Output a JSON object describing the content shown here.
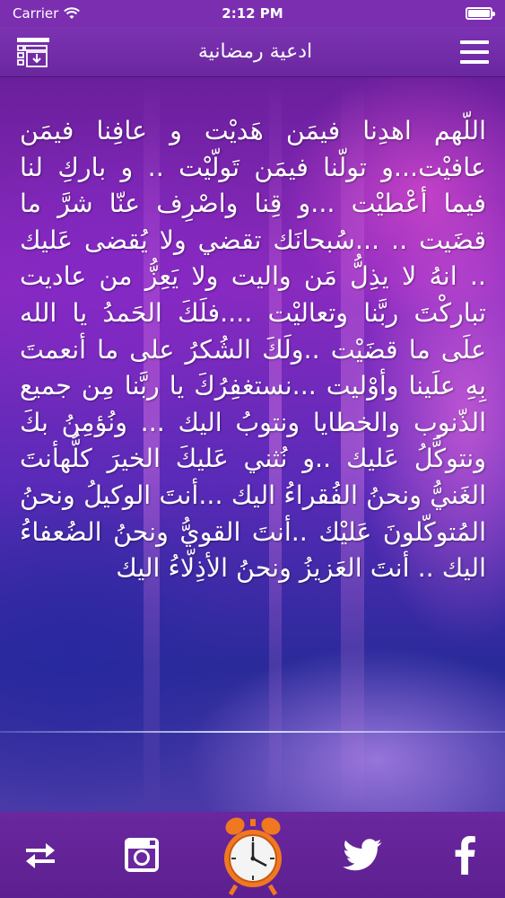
{
  "status_bar": {
    "carrier": "Carrier",
    "time": "2:12 PM"
  },
  "nav": {
    "title": "ادعية رمضانية"
  },
  "dua": {
    "text": "اللّهم اهدِنا فيمَن هَديْت و عافِنا فيمَن عافيْت...و تولّنا فيمَن تَولّيْت .. و باركِ لنا فيما أعْطيْت ...و قِنا واصْرِف عنّا شرَّ ما قضَيت .. ...سُبحانَك تقضي ولا يُقضى عَليك .. انهُ لا يذِلُّ مَن واليت ولا يَعِزُّ من عاديت تباركْتَ ربَّنا وتعاليْت ....فلَكَ الحَمدُ يا الله علَى ما قضَيْت ..ولَكَ الشُكرُ على ما أنعمتَ بِهِ علَينا وأوْليت ...نستغفِرُكَ يا ربَّنا مِن جميع الذّنوب والخطايا ونتوبُ اليك ... ونُؤمِنُ بكَ ونتوكَّلُ عَليك ..و نُثني عَليكَ الخيرَ كلُّهأنتَ الغَنيُّ ونحنُ الفُقراءُ اليك ...أنتَ الوكيلُ ونحنُ المُتوكّلونَ عَليْك ..أنتَ القويُّ ونحنُ الضُعفاءُ اليك .. أنتَ العَزيزُ ونحنُ الأذِلّاءُ اليك"
  },
  "icons": {
    "menu": "hamburger-menu-icon",
    "list": "list-download-icon",
    "facebook": "facebook-icon",
    "twitter": "twitter-icon",
    "alarm": "alarm-clock-icon",
    "instagram": "instagram-icon",
    "refresh": "refresh-arrows-icon"
  },
  "colors": {
    "bar": "#6a279f",
    "status": "#7b2fb0",
    "clock_orange": "#f07820"
  }
}
